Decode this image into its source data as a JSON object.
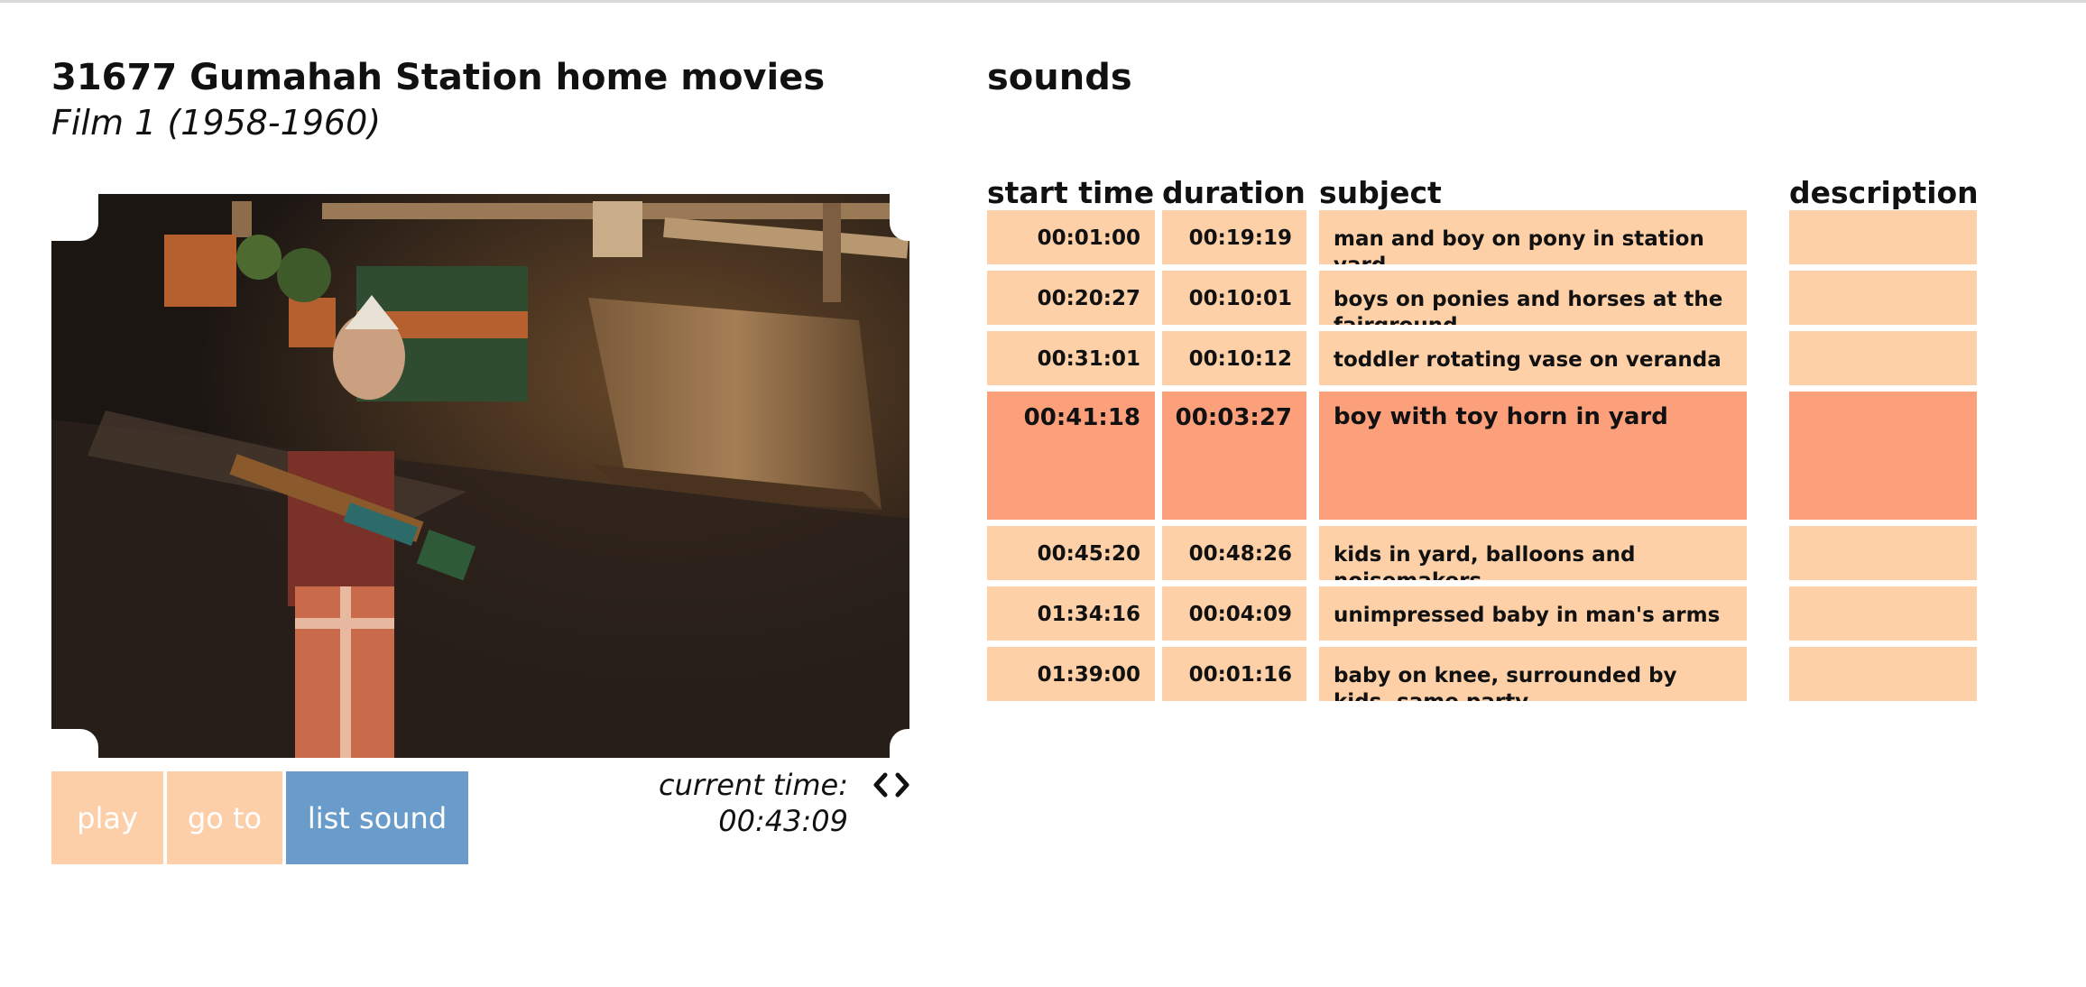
{
  "header": {
    "title": "31677 Gumahah Station home movies",
    "subtitle": "Film 1 (1958-1960)"
  },
  "player": {
    "buttons": {
      "play": "play",
      "goto": "go to",
      "list_sound": "list sound"
    },
    "current_time_label": "current time: 00:43:09"
  },
  "sounds": {
    "title": "sounds",
    "columns": {
      "start": "start time",
      "duration": "duration",
      "subject": "subject",
      "description": "description"
    },
    "rows": [
      {
        "start": "00:01:00",
        "duration": "00:19:19",
        "subject": "man and boy on pony in station yard",
        "description": ""
      },
      {
        "start": "00:20:27",
        "duration": "00:10:01",
        "subject": "boys on ponies and horses at the fairground",
        "description": ""
      },
      {
        "start": "00:31:01",
        "duration": "00:10:12",
        "subject": "toddler rotating vase on veranda",
        "description": ""
      },
      {
        "start": "00:41:18",
        "duration": "00:03:27",
        "subject": "boy with toy horn in yard",
        "description": ""
      },
      {
        "start": "00:45:20",
        "duration": "00:48:26",
        "subject": "kids in yard, balloons and noisemakers",
        "description": ""
      },
      {
        "start": "01:34:16",
        "duration": "00:04:09",
        "subject": "unimpressed baby in man's arms",
        "description": ""
      },
      {
        "start": "01:39:00",
        "duration": "00:01:16",
        "subject": "baby on knee, surrounded by kids, same party",
        "description": ""
      }
    ]
  }
}
